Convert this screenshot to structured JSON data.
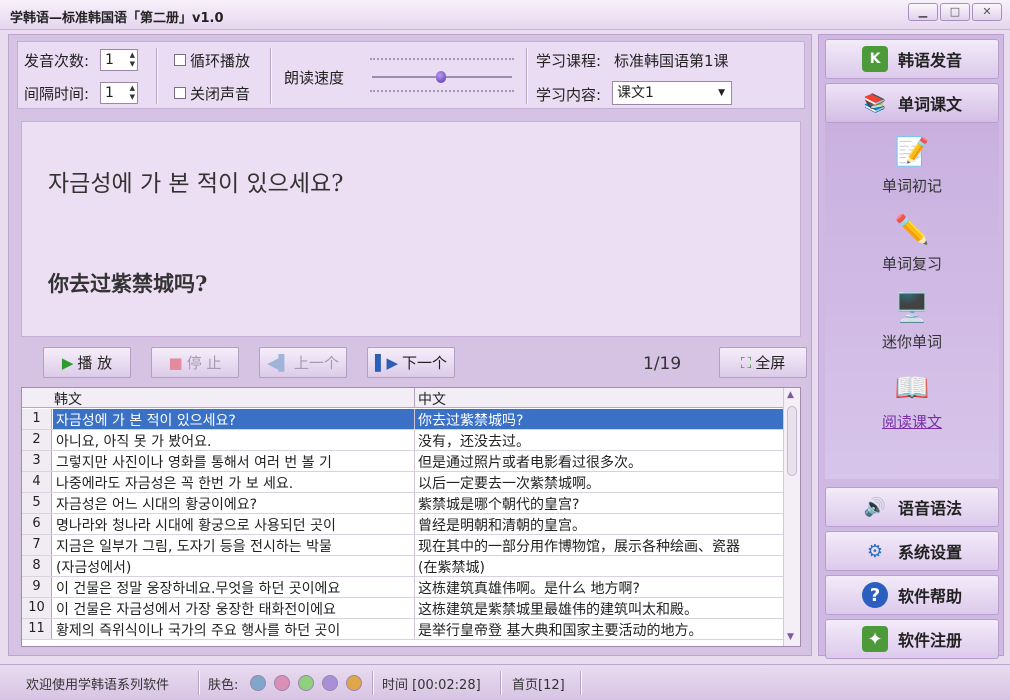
{
  "window": {
    "title": "学韩语—标准韩国语「第二册」v1.0",
    "btn_min": "▁",
    "btn_max": "□",
    "btn_close": "✕"
  },
  "controls": {
    "play_count_label": "发音次数:",
    "play_count_value": "1",
    "interval_label": "间隔时间:",
    "interval_value": "1",
    "loop_label": "循环播放",
    "mute_label": "关闭声音",
    "speed_label": "朗读速度",
    "course_label": "学习课程:",
    "course_value": "标准韩国语第1课",
    "content_label": "学习内容:",
    "content_value": "课文1"
  },
  "display": {
    "korean": "자금성에 가 본 적이 있으세요?",
    "chinese": "你去过紫禁城吗?"
  },
  "toolbar": {
    "play": "播 放",
    "stop": "停 止",
    "prev": "上一个",
    "next": "下一个",
    "page": "1/19",
    "fullscreen": "全屏"
  },
  "table": {
    "col_korean": "韩文",
    "col_chinese": "中文",
    "rows": [
      {
        "num": "1",
        "ko": "자금성에 가 본 적이 있으세요?",
        "zh": "你去过紫禁城吗?"
      },
      {
        "num": "2",
        "ko": "아니요, 아직 못 가 봤어요.",
        "zh": "没有，还没去过。"
      },
      {
        "num": "3",
        "ko": "그렇지만 사진이나 영화를 통해서 여러 번 볼 기",
        "zh": "但是通过照片或者电影看过很多次。"
      },
      {
        "num": "4",
        "ko": "나중에라도 자금성은 꼭 한번 가 보 세요.",
        "zh": "以后一定要去一次紫禁城啊。"
      },
      {
        "num": "5",
        "ko": "자금성은 어느 시대의 황궁이에요?",
        "zh": "紫禁城是哪个朝代的皇宫?"
      },
      {
        "num": "6",
        "ko": "명나라와 청나라 시대에 황궁으로 사용되던 곳이",
        "zh": "曾经是明朝和清朝的皇宫。"
      },
      {
        "num": "7",
        "ko": "지금은 일부가 그림, 도자기 등을 전시하는 박물",
        "zh": "现在其中的一部分用作博物馆，展示各种绘画、瓷器"
      },
      {
        "num": "8",
        "ko": "(자금성에서)",
        "zh": "(在紫禁城)"
      },
      {
        "num": "9",
        "ko": "이 건물은 정말 웅장하네요.무엇을 하던 곳이에요",
        "zh": "这栋建筑真雄伟啊。是什么 地方啊?"
      },
      {
        "num": "10",
        "ko": "이 건물은 자금성에서 가장 웅장한 태화전이에요",
        "zh": "这栋建筑是紫禁城里最雄伟的建筑叫太和殿。"
      },
      {
        "num": "11",
        "ko": "황제의 즉위식이나 국가의 주요 행사를 하던 곳이",
        "zh": "是举行皇帝登 基大典和国家主要活动的地方。"
      }
    ]
  },
  "sidebar": {
    "pronunciation": "韩语发音",
    "vocab_text": "单词课文",
    "sub": {
      "first_memory": "单词初记",
      "review": "单词复习",
      "mini": "迷你单词",
      "reading": "阅读课文"
    },
    "grammar": "语音语法",
    "settings": "系统设置",
    "help": "软件帮助",
    "register": "软件注册"
  },
  "status": {
    "welcome": "欢迎使用学韩语系列软件",
    "skin_label": "肤色:",
    "skin_colors": [
      "#7fa7c9",
      "#d98fb6",
      "#8fd07f",
      "#a98fd6",
      "#e0a64a"
    ],
    "time": "时间 [00:02:28]",
    "home": "首页[12]"
  },
  "colors": {
    "accent": "#3a71c5",
    "link_active": "#7a2fa8"
  }
}
